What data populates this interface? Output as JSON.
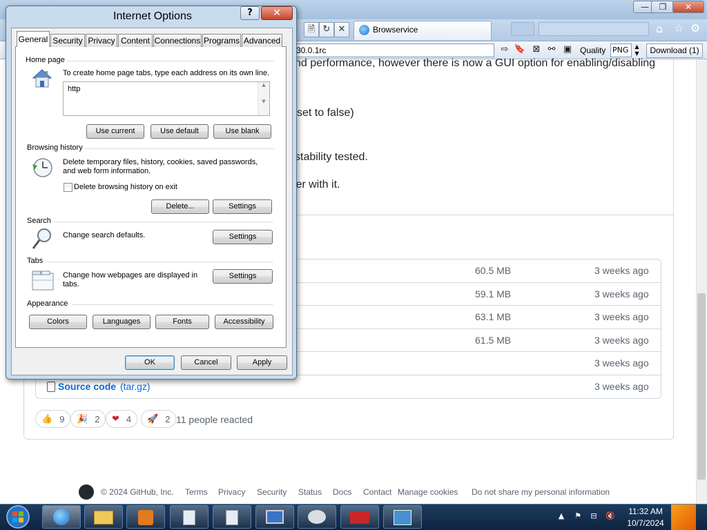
{
  "browser": {
    "tab_title": "Browservice",
    "address": "30.0.1rc",
    "quality_label": "Quality",
    "quality_value": "PNG",
    "download_label": "Download (1)",
    "title_buttons": {
      "minimize": "—",
      "maximize": "❐",
      "close": "✕"
    }
  },
  "page": {
    "lines": [
      "nd performance, however there is now a GUI option for enabling/disabling",
      "set to false)",
      "stability tested.",
      "ter with it."
    ],
    "assets": [
      {
        "size": "60.5 MB",
        "date": "3 weeks ago"
      },
      {
        "size": "59.1 MB",
        "date": "3 weeks ago"
      },
      {
        "size": "63.1 MB",
        "date": "3 weeks ago"
      },
      {
        "size": "61.5 MB",
        "date": "3 weeks ago"
      },
      {
        "size": "",
        "date": "3 weeks ago"
      }
    ],
    "source_code": {
      "label": "Source code",
      "format": "(tar.gz)",
      "date": "3 weeks ago"
    },
    "reactions": [
      {
        "emoji": "👍",
        "count": "9"
      },
      {
        "emoji": "🎉",
        "count": "2"
      },
      {
        "emoji": "❤",
        "count": "4"
      },
      {
        "emoji": "🚀",
        "count": "2"
      }
    ],
    "reacted_text": "11 people reacted",
    "footer": {
      "copyright": "© 2024 GitHub, Inc.",
      "links": [
        "Terms",
        "Privacy",
        "Security",
        "Status",
        "Docs",
        "Contact",
        "Manage cookies",
        "Do not share my personal information"
      ]
    }
  },
  "dialog": {
    "title": "Internet Options",
    "help": "?",
    "close": "✕",
    "tabs": [
      "General",
      "Security",
      "Privacy",
      "Content",
      "Connections",
      "Programs",
      "Advanced"
    ],
    "home_page": {
      "label": "Home page",
      "description": "To create home page tabs, type each address on its own line.",
      "value": "http",
      "use_current": "Use current",
      "use_default": "Use default",
      "use_blank": "Use blank"
    },
    "browsing_history": {
      "label": "Browsing history",
      "description": "Delete temporary files, history, cookies, saved passwords, and web form information.",
      "checkbox_label": "Delete browsing history on exit",
      "delete": "Delete...",
      "settings": "Settings"
    },
    "search": {
      "label": "Search",
      "description": "Change search defaults.",
      "settings": "Settings"
    },
    "tabs_group": {
      "label": "Tabs",
      "description": "Change how webpages are displayed in tabs.",
      "settings": "Settings"
    },
    "appearance": {
      "label": "Appearance",
      "colors": "Colors",
      "languages": "Languages",
      "fonts": "Fonts",
      "accessibility": "Accessibility"
    },
    "ok": "OK",
    "cancel": "Cancel",
    "apply": "Apply"
  },
  "taskbar": {
    "time": "11:32 AM",
    "date": "10/7/2024"
  }
}
